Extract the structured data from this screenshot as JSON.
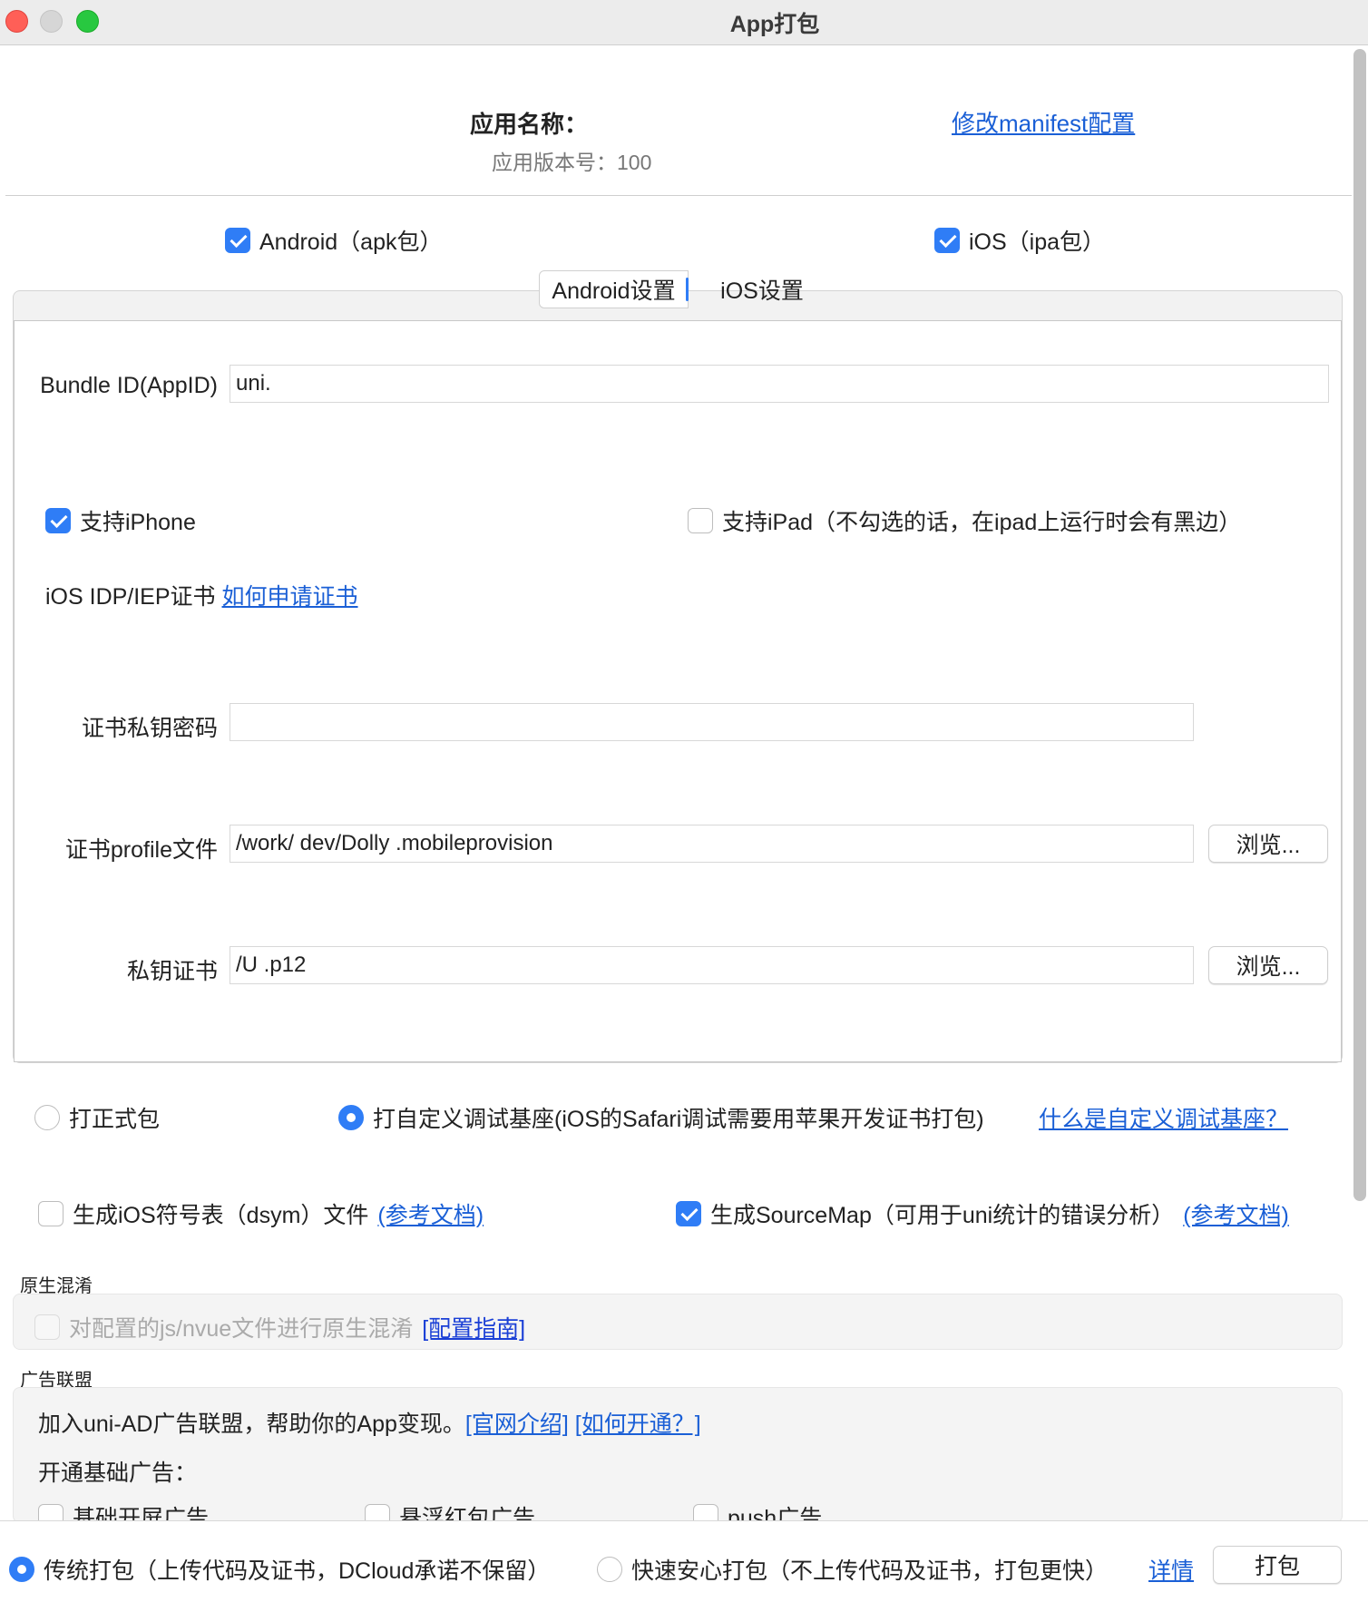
{
  "window": {
    "title": "App打包"
  },
  "header": {
    "app_name_label": "应用名称：",
    "app_version": "应用版本号：100",
    "manifest_link": "修改manifest配置"
  },
  "platforms": {
    "android": {
      "label": "Android（apk包）",
      "checked": true
    },
    "ios": {
      "label": "iOS（ipa包）",
      "checked": true
    }
  },
  "tabs": [
    {
      "label": "Android设置",
      "active": true
    },
    {
      "label": "iOS设置",
      "active": false
    }
  ],
  "ios_settings": {
    "bundle_id_label": "Bundle ID(AppID)",
    "bundle_id_value": "uni.",
    "support_iphone": {
      "label": "支持iPhone",
      "checked": true
    },
    "support_ipad": {
      "label": "支持iPad（不勾选的话，在ipad上运行时会有黑边）",
      "checked": false
    },
    "cert_label": "iOS IDP/IEP证书",
    "cert_link": "如何申请证书",
    "cert_password_label": "证书私钥密码",
    "cert_password_value": "",
    "profile_label": "证书profile文件",
    "profile_value": "/work/                               dev/Dolly                     .mobileprovision",
    "private_key_label": "私钥证书",
    "private_key_value": "/U                                                                              .p12",
    "browse_label": "浏览..."
  },
  "build_type": {
    "release": {
      "label": "打正式包",
      "selected": false
    },
    "custom_base": {
      "label": "打自定义调试基座(iOS的Safari调试需要用苹果开发证书打包)",
      "selected": true
    },
    "custom_base_link": "什么是自定义调试基座？"
  },
  "extras": {
    "dsym": {
      "label": "生成iOS符号表（dsym）文件",
      "checked": false,
      "link": "(参考文档)"
    },
    "sourcemap": {
      "label": "生成SourceMap（可用于uni统计的错误分析）",
      "checked": true,
      "link": "(参考文档)"
    }
  },
  "obfuscation": {
    "section_title": "原生混淆",
    "option_label": "对配置的js/nvue文件进行原生混淆",
    "link": "[配置指南]"
  },
  "ads": {
    "section_title": "广告联盟",
    "intro": "加入uni-AD广告联盟，帮助你的App变现。",
    "link_intro": "[官网介绍]",
    "link_how": "[如何开通？]",
    "basic_title": "开通基础广告：",
    "options": [
      "基础开屏广告",
      "悬浮红包广告",
      "push广告"
    ]
  },
  "footer": {
    "traditional": {
      "label": "传统打包（上传代码及证书，DCloud承诺不保留）",
      "selected": true
    },
    "fast": {
      "label": "快速安心打包（不上传代码及证书，打包更快）",
      "selected": false
    },
    "details_link": "详情",
    "build_button": "打包"
  },
  "colors": {
    "accent": "#2f7df6",
    "link": "#1a5fd6"
  }
}
